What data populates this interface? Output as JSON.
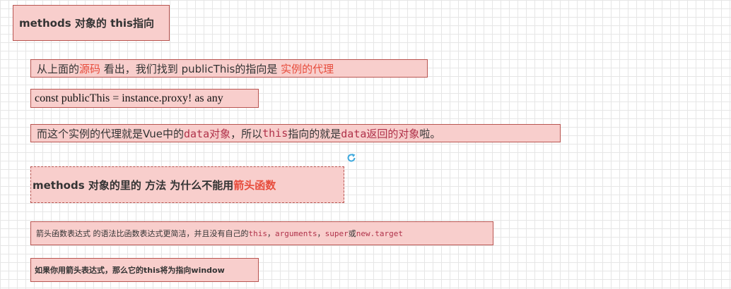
{
  "box1": {
    "text": "methods 对象的 this指向"
  },
  "box2": {
    "t1": "从上面的",
    "t2": "源码",
    "t3": " 看出，我们找到 publicThis的指向是 ",
    "t4": "实例的代理"
  },
  "box3": {
    "text": "const publicThis = instance.proxy! as any"
  },
  "box4": {
    "t1": "而这个实例的代理就是Vue中的",
    "t2": "data对象",
    "t3": "，所以",
    "t4": "this",
    "t5": "指向的就是",
    "t6": "data返回的对象",
    "t7": "啦。"
  },
  "box5": {
    "t1": "methods 对象的里的 方法 为什么不能用",
    "t2": "箭头函数"
  },
  "box6": {
    "t1": "箭头函数表达式 的语法比函数表达式更简洁，并且没有自己的",
    "t2": "this",
    "t3": "，",
    "t4": "arguments",
    "t5": "，",
    "t6": "super",
    "t7": "或",
    "t8": "new.target"
  },
  "box7": {
    "text": "如果你用箭头表达式，那么它的this将为指向window"
  },
  "icons": {
    "refresh": "refresh-icon"
  },
  "colors": {
    "box_fill": "#f8cecc",
    "box_border": "#b85450",
    "highlight": "#e74c3c",
    "code": "#b0324a",
    "icon": "#3fa9dd"
  }
}
